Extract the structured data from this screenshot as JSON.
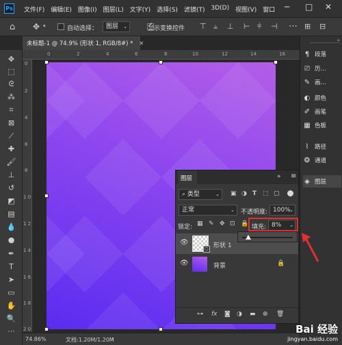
{
  "app": {
    "logo": "Ps",
    "menus": [
      "文件(F)",
      "编辑(E)",
      "图像(I)",
      "图层(L)",
      "文字(Y)",
      "选择(S)",
      "滤镜(T)",
      "3D(D)",
      "视图(V)",
      "窗口"
    ],
    "window_controls": [
      "minimize-icon",
      "restore-icon",
      "close-icon"
    ]
  },
  "options": {
    "auto_select_label": "自动选择：",
    "auto_select_checked": false,
    "auto_select_target": "图层",
    "show_transform_label": "显示变换控件",
    "show_transform_checked": true
  },
  "document": {
    "tab_title": "未标题-1 @ 74.9% (形状 1, RGB/8#) *",
    "ruler_ticks": [
      "0",
      "2",
      "4",
      "6",
      "8",
      "10",
      "12",
      "14",
      "16"
    ],
    "ruler_left_ticks": [
      "0",
      "2",
      "4",
      "6",
      "8",
      "1 0",
      "1 2",
      "1 4",
      "1 6",
      "1 8",
      "2 0"
    ]
  },
  "status": {
    "zoom": "74.86%",
    "doc_info": "文档:1.20M/1.20M"
  },
  "right_panel": {
    "items": [
      "段落",
      "历…",
      "画…",
      "颜色",
      "画笔",
      "色板",
      "路径",
      "通道",
      "图层"
    ]
  },
  "layers": {
    "title": "图层",
    "filter": "类型",
    "blend_mode": "正常",
    "opacity_label": "不透明度:",
    "opacity_value": "100%",
    "lock_label": "锁定:",
    "fill_label": "填充:",
    "fill_value": "8%",
    "rows": [
      {
        "name": "形状 1",
        "selected": true
      },
      {
        "name": "背景",
        "selected": false
      }
    ]
  },
  "watermark": {
    "text": "Bai 经验",
    "url": "jingyan.baidu.com"
  }
}
